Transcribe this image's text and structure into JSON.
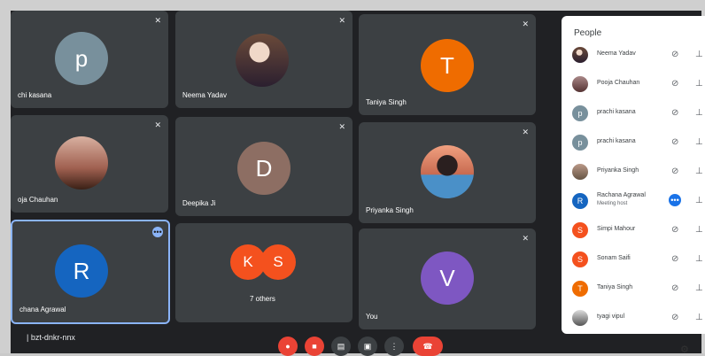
{
  "tiles": [
    {
      "name": "chi kasana",
      "avatar_letter": "p",
      "avatar_color": "#78909c"
    },
    {
      "name": "Neema Yadav",
      "photo": "baby"
    },
    {
      "name": "Taniya Singh",
      "avatar_letter": "T",
      "avatar_color": "#ef6c00"
    },
    {
      "name": "oja Chauhan",
      "photo": "sunset"
    },
    {
      "name": "Deepika Ji",
      "avatar_letter": "D",
      "avatar_color": "#8d6e63"
    },
    {
      "name": "Priyanka Singh",
      "photo": "girl"
    },
    {
      "name": "chana Agrawal",
      "avatar_letter": "R",
      "avatar_color": "#1565c0",
      "more": "•••"
    },
    {
      "name": "7 others",
      "group": [
        {
          "letter": "K",
          "color": "#f4511e"
        },
        {
          "letter": "S",
          "color": "#f4511e"
        }
      ]
    },
    {
      "name": "You",
      "avatar_letter": "V",
      "avatar_color": "#7e57c2"
    }
  ],
  "people": {
    "title": "People",
    "list": [
      {
        "name": "Neema Yadav",
        "photo": "baby"
      },
      {
        "name": "Pooja Chauhan",
        "photo": "pooja"
      },
      {
        "name": "prachi kasana",
        "letter": "p",
        "color": "#78909c"
      },
      {
        "name": "prachi kasana",
        "letter": "p",
        "color": "#78909c"
      },
      {
        "name": "Priyanka Singh",
        "photo": "priyanka"
      },
      {
        "name": "Rachana Agrawal",
        "sub": "Meeting host",
        "letter": "R",
        "color": "#1565c0",
        "dots": "•••"
      },
      {
        "name": "Simpi Mahour",
        "letter": "S",
        "color": "#f4511e"
      },
      {
        "name": "Sonam Saifi",
        "letter": "S",
        "color": "#f4511e"
      },
      {
        "name": "Taniya Singh",
        "letter": "T",
        "color": "#ef6c00"
      },
      {
        "name": "tyagi vipul",
        "photo": "tyagi"
      }
    ]
  },
  "footer": {
    "meeting_code": "| bzt-dnkr-nnx"
  },
  "icons": {
    "mic_off": "🔇",
    "pin": "📌",
    "present": "▣",
    "more": "⋮",
    "end": "☎"
  }
}
